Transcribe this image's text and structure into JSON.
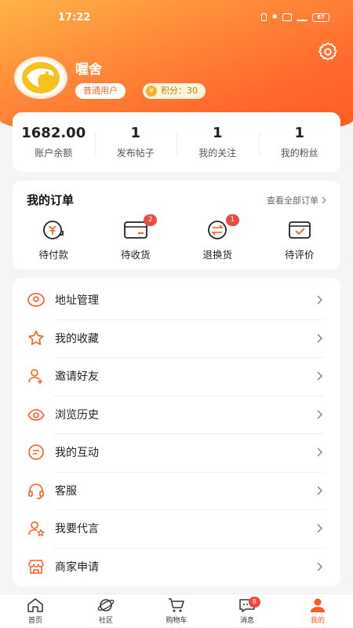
{
  "status_bar": {
    "time": "17:22",
    "battery": "67"
  },
  "profile": {
    "username": "喔舍",
    "user_level": "普通用户",
    "points_label": "积分：30",
    "coin_symbol": "¥"
  },
  "stats": [
    {
      "value": "1682.00",
      "label": "账户余额"
    },
    {
      "value": "1",
      "label": "发布帖子"
    },
    {
      "value": "1",
      "label": "我的关注"
    },
    {
      "value": "1",
      "label": "我的粉丝"
    }
  ],
  "orders": {
    "title": "我的订单",
    "view_all": "查看全部订单",
    "items": [
      {
        "label": "待付款",
        "icon": "payment-icon",
        "badge": ""
      },
      {
        "label": "待收货",
        "icon": "wallet-icon",
        "badge": "2"
      },
      {
        "label": "退换货",
        "icon": "exchange-icon",
        "badge": "1"
      },
      {
        "label": "待评价",
        "icon": "review-icon",
        "badge": ""
      }
    ]
  },
  "menu": [
    {
      "label": "地址管理",
      "icon": "location-icon"
    },
    {
      "label": "我的收藏",
      "icon": "star-icon"
    },
    {
      "label": "邀请好友",
      "icon": "invite-user-icon"
    },
    {
      "label": "浏览历史",
      "icon": "eye-icon"
    },
    {
      "label": "我的互动",
      "icon": "chat-bubble-icon"
    },
    {
      "label": "客服",
      "icon": "headset-icon"
    },
    {
      "label": "我要代言",
      "icon": "endorse-icon"
    },
    {
      "label": "商家申请",
      "icon": "shop-icon"
    }
  ],
  "tabbar": [
    {
      "label": "首页",
      "icon": "home-icon",
      "badge": ""
    },
    {
      "label": "社区",
      "icon": "planet-icon",
      "badge": ""
    },
    {
      "label": "购物车",
      "icon": "cart-icon",
      "badge": ""
    },
    {
      "label": "消息",
      "icon": "message-icon",
      "badge": "8"
    },
    {
      "label": "我的",
      "icon": "profile-icon",
      "badge": ""
    }
  ],
  "colors": {
    "accent": "#ff5a22",
    "badge": "#f04a3e"
  }
}
